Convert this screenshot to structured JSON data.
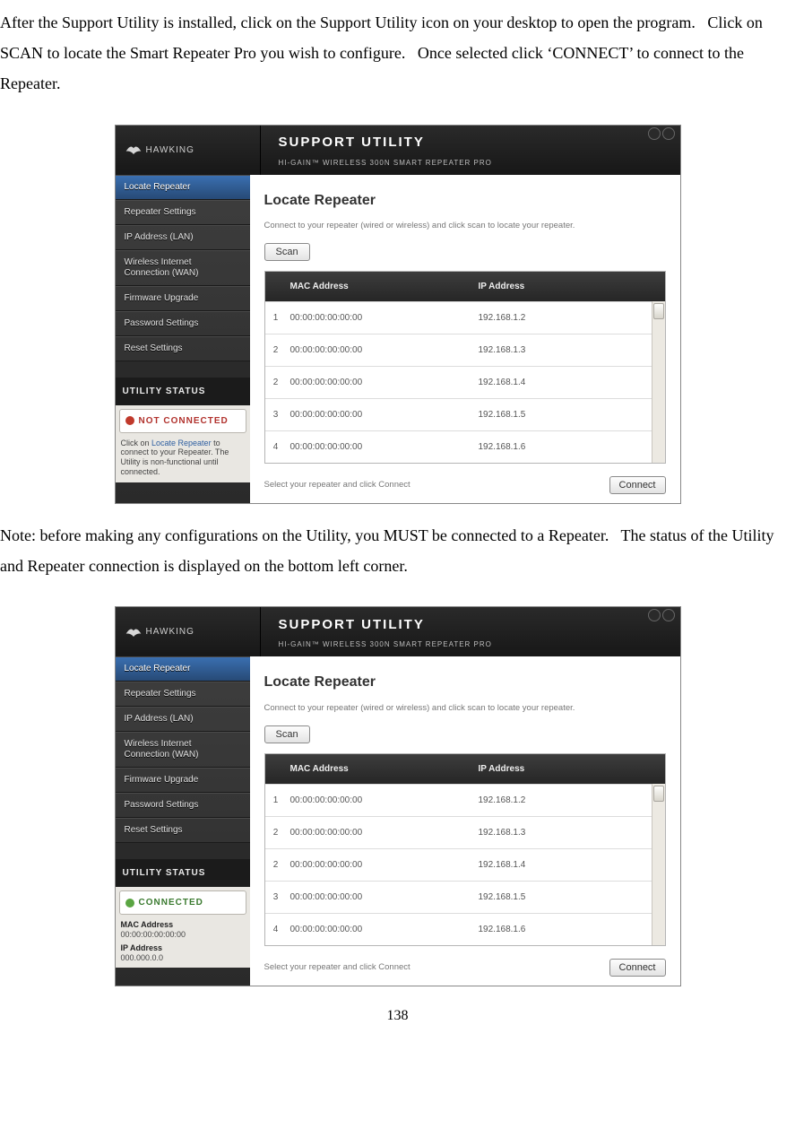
{
  "page_number": "138",
  "paragraphs": {
    "p1": "After the Support Utility is installed, click on the Support Utility icon on your desktop to open the program.   Click on SCAN to locate the Smart Repeater Pro you wish to configure.   Once selected click ‘CONNECT’ to connect to the Repeater.",
    "p2": "Note: before making any configurations on the Utility, you MUST be connected to a Repeater.   The status of the Utility and Repeater connection is displayed on the bottom left corner."
  },
  "app": {
    "brand": "HAWKING",
    "title": "SUPPORT UTILITY",
    "subtitle": "HI-GAIN™ WIRELESS 300N SMART REPEATER PRO",
    "sidebar": {
      "items": [
        {
          "label": "Locate Repeater",
          "active": true
        },
        {
          "label": "Repeater Settings"
        },
        {
          "label": "IP Address (LAN)"
        },
        {
          "label": "Wireless Internet\nConnection (WAN)"
        },
        {
          "label": "Firmware Upgrade"
        },
        {
          "label": "Password Settings"
        },
        {
          "label": "Reset Settings"
        }
      ],
      "status_title": "UTILITY STATUS"
    },
    "status": {
      "not_connected": {
        "label": "NOT CONNECTED",
        "note_prefix": "Click on ",
        "note_link": "Locate Repeater",
        "note_suffix": " to connect to your Repeater.  The Utility is non-functional until connected."
      },
      "connected": {
        "label": "CONNECTED",
        "mac_label": "MAC Address",
        "mac_value": "00:00:00:00:00:00",
        "ip_label": "IP Address",
        "ip_value": "000.000.0.0"
      }
    },
    "panel": {
      "title": "Locate Repeater",
      "subtitle": "Connect to your repeater (wired or wireless) and click scan to locate your repeater.",
      "scan_label": "Scan",
      "cols": {
        "mac": "MAC Address",
        "ip": "IP Address"
      },
      "rows": [
        {
          "idx": "1",
          "mac": "00:00:00:00:00:00",
          "ip": "192.168.1.2"
        },
        {
          "idx": "2",
          "mac": "00:00:00:00:00:00",
          "ip": "192.168.1.3"
        },
        {
          "idx": "2",
          "mac": "00:00:00:00:00:00",
          "ip": "192.168.1.4"
        },
        {
          "idx": "3",
          "mac": "00:00:00:00:00:00",
          "ip": "192.168.1.5"
        },
        {
          "idx": "4",
          "mac": "00:00:00:00:00:00",
          "ip": "192.168.1.6"
        }
      ],
      "connect_hint": "Select your repeater and click Connect",
      "connect_label": "Connect"
    }
  }
}
